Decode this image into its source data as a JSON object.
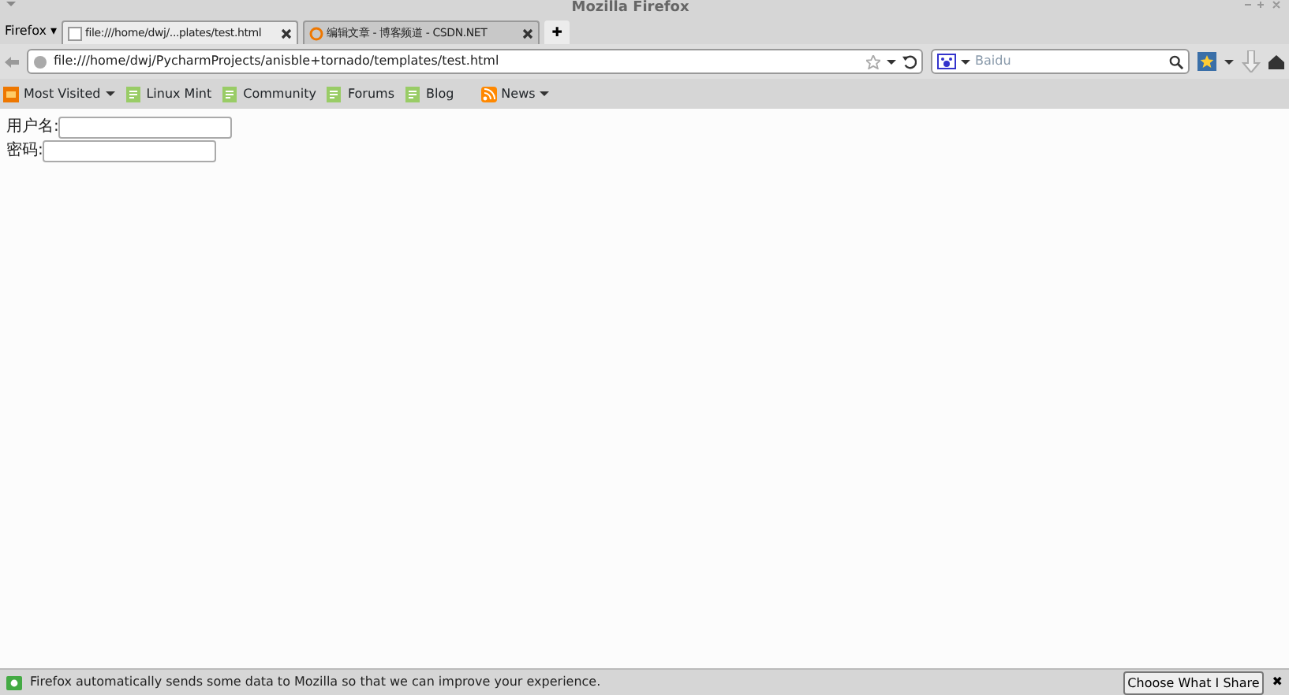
{
  "window": {
    "title": "Mozilla Firefox"
  },
  "app_menu": {
    "label": "Firefox ▾"
  },
  "tabs": [
    {
      "title": "file:///home/dwj/...plates/test.html",
      "selected": true
    },
    {
      "title": "编辑文章 - 博客频道 - CSDN.NET",
      "selected": false
    }
  ],
  "new_tab": {
    "label": "✚"
  },
  "address_bar": {
    "value": "file:///home/dwj/PycharmProjects/anisble+tornado/templates/test.html"
  },
  "search_bar": {
    "placeholder": "Baidu"
  },
  "bookmarks": [
    {
      "label": "Most Visited",
      "kind": "folder"
    },
    {
      "label": "Linux Mint",
      "kind": "page"
    },
    {
      "label": "Community",
      "kind": "page"
    },
    {
      "label": "Forums",
      "kind": "page"
    },
    {
      "label": "Blog",
      "kind": "page"
    },
    {
      "label": "News",
      "kind": "feed"
    }
  ],
  "form": [
    {
      "label": "用户名:"
    },
    {
      "label": "密码:"
    }
  ],
  "notification": {
    "message": "Firefox automatically sends some data to Mozilla so that we can improve your experience.",
    "button": "Choose What I Share",
    "close": "✖"
  }
}
